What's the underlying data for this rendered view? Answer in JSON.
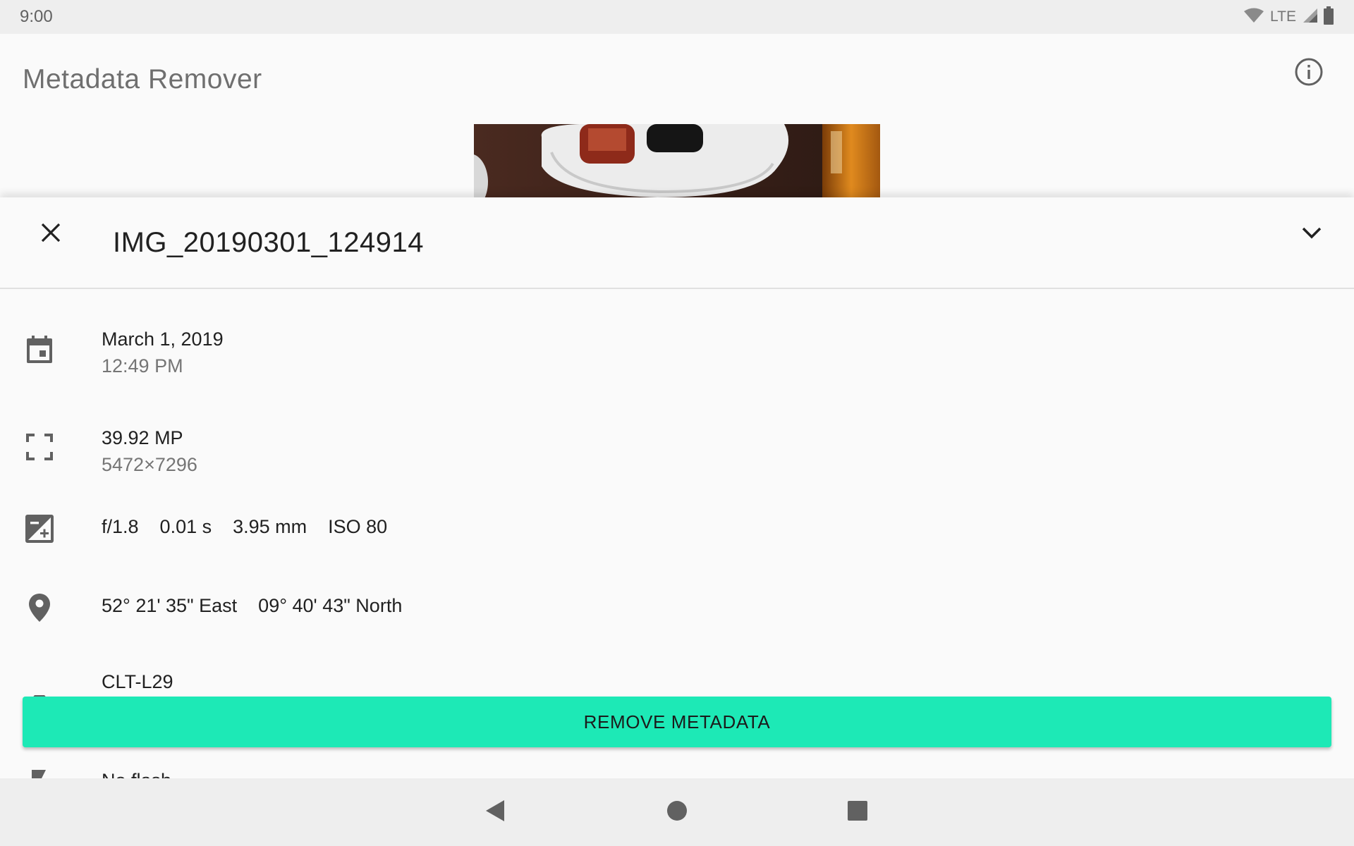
{
  "status_bar": {
    "time": "9:00",
    "network": "LTE",
    "icons": [
      "wifi-icon",
      "signal-icon",
      "battery-icon"
    ]
  },
  "app_bar": {
    "title": "Metadata Remover",
    "info_icon": "info-icon"
  },
  "sheet": {
    "file_name": "IMG_20190301_124914",
    "close_icon": "close-icon",
    "collapse_icon": "chevron-down-icon",
    "date": {
      "icon": "calendar-icon",
      "primary": "March 1, 2019",
      "secondary": "12:49 PM"
    },
    "resolution": {
      "icon": "fullscreen-icon",
      "primary": "39.92 MP",
      "secondary": "5472×7296"
    },
    "exposure": {
      "icon": "exposure-icon",
      "aperture": "f/1.8",
      "shutter": "0.01 s",
      "focal_length": "3.95 mm",
      "iso": "ISO 80"
    },
    "location": {
      "icon": "location-pin-icon",
      "longitude": "52° 21' 35\" East",
      "latitude": "09° 40' 43\" North"
    },
    "camera": {
      "icon": "camera-icon",
      "primary": "CLT-L29"
    },
    "flash": {
      "icon": "flash-icon",
      "primary": "No flash"
    }
  },
  "actions": {
    "remove_label": "REMOVE METADATA"
  },
  "colors": {
    "accent": "#1de9b6",
    "status_bar": "#eeeeee",
    "background": "#fafafa",
    "icon_gray": "#616161"
  },
  "nav_bar": {
    "icons": [
      "back-icon",
      "home-icon",
      "recents-icon"
    ]
  }
}
